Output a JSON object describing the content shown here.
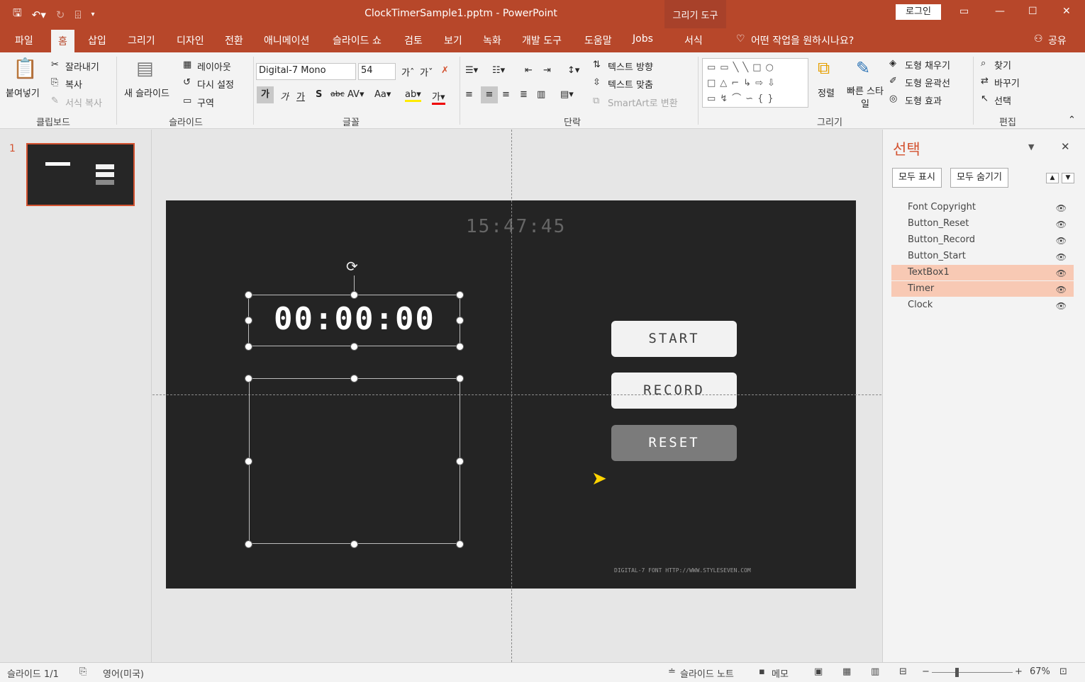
{
  "window": {
    "title": "ClockTimerSample1.pptm  -  PowerPoint",
    "context_group": "그리기 도구",
    "login": "로그인"
  },
  "tabs": [
    "파일",
    "홈",
    "삽입",
    "그리기",
    "디자인",
    "전환",
    "애니메이션",
    "슬라이드 쇼",
    "검토",
    "보기",
    "녹화",
    "개발 도구",
    "도움말",
    "Jobs"
  ],
  "context_tab": "서식",
  "tell_me": "어떤 작업을 원하시나요?",
  "share": "공유",
  "ribbon": {
    "clipboard": {
      "paste": "붙여넣기",
      "cut": "잘라내기",
      "copy": "복사",
      "format_painter": "서식 복사",
      "label": "클립보드"
    },
    "slides": {
      "new_slide": "새 슬라이드",
      "layout": "레이아웃",
      "reset": "다시 설정",
      "section": "구역",
      "label": "슬라이드"
    },
    "font": {
      "name": "Digital-7 Mono",
      "size": "54",
      "label": "글꼴"
    },
    "paragraph": {
      "text_direction": "텍스트 방향",
      "align_text": "텍스트 맞춤",
      "smartart": "SmartArt로 변환",
      "label": "단락"
    },
    "drawing": {
      "arrange": "정렬",
      "quick_styles": "빠른 스타일",
      "fill": "도형 채우기",
      "outline": "도형 윤곽선",
      "effects": "도형 효과",
      "label": "그리기"
    },
    "editing": {
      "find": "찾기",
      "replace": "바꾸기",
      "select": "선택",
      "label": "편집"
    }
  },
  "thumbnail": {
    "number": "1"
  },
  "slide": {
    "clock": "15:47:45",
    "timer": "00:00:00",
    "buttons": {
      "start": "START",
      "record": "RECORD",
      "reset": "RESET"
    },
    "copyright": "DIGITAL-7 FONT HTTP://WWW.STYLESEVEN.COM"
  },
  "selection_pane": {
    "title": "선택",
    "show_all": "모두 표시",
    "hide_all": "모두 숨기기",
    "items": [
      {
        "name": "Font Copyright",
        "selected": false
      },
      {
        "name": "Button_Reset",
        "selected": false
      },
      {
        "name": "Button_Record",
        "selected": false
      },
      {
        "name": "Button_Start",
        "selected": false
      },
      {
        "name": "TextBox1",
        "selected": true
      },
      {
        "name": "Timer",
        "selected": true
      },
      {
        "name": "Clock",
        "selected": false
      }
    ]
  },
  "status": {
    "slide": "슬라이드 1/1",
    "language": "영어(미국)",
    "notes": "슬라이드 노트",
    "comments": "메모",
    "zoom": "67%"
  },
  "colors": {
    "accent": "#b7472a",
    "selected_row": "#f8c9b4",
    "slide_bg": "#242424"
  }
}
